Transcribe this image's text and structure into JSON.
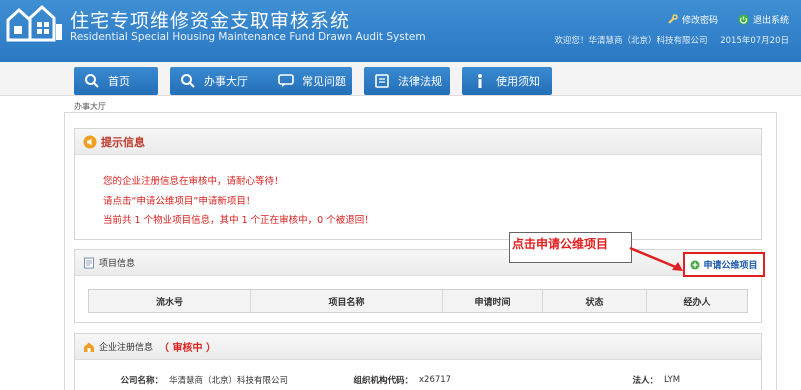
{
  "header": {
    "title": "住宅专项维修资金支取审核系统",
    "subtitle": "Residential Special Housing Maintenance Fund Drawn Audit System",
    "links": [
      {
        "label": "修改密码",
        "icon": "wrench-icon"
      },
      {
        "label": "退出系统",
        "icon": "power-icon"
      }
    ],
    "welcome": "欢迎您！华清慧商（北京）科技有限公司",
    "date": "2015年07月20日"
  },
  "nav": [
    {
      "label": "首页",
      "icon": "search-icon"
    },
    {
      "label": "办事大厅",
      "icon": "search-icon"
    },
    {
      "label": "常见问题",
      "icon": "chat-icon"
    },
    {
      "label": "法律法规",
      "icon": "book-icon"
    },
    {
      "label": "使用须知",
      "icon": "info-icon"
    }
  ],
  "breadcrumb": "办事大厅",
  "notice": {
    "title": "提示信息",
    "lines": [
      "您的企业注册信息在审核中，请耐心等待！",
      "请点击“申请公维项目”申请新项目！",
      "当前共 1 个物业项目信息，其中 1 个正在审核中，0 个被退回！"
    ]
  },
  "project": {
    "title": "项目信息",
    "apply_button": "申请公维项目",
    "callout": "点击申请公维项目",
    "columns": [
      "流水号",
      "项目名称",
      "申请时间",
      "状态",
      "经办人"
    ]
  },
  "company": {
    "title": "企业注册信息",
    "status": "（ 审核中 ）",
    "fields": [
      {
        "label": "公司名称：",
        "value": "华清慧商（北京）科技有限公司"
      },
      {
        "label": "组织机构代码：",
        "value": "x26717"
      },
      {
        "label": "法人：",
        "value": "LYM"
      }
    ]
  },
  "colors": {
    "header": "#2a78c2",
    "nav": "#236fb8",
    "alert": "#d6201d"
  }
}
